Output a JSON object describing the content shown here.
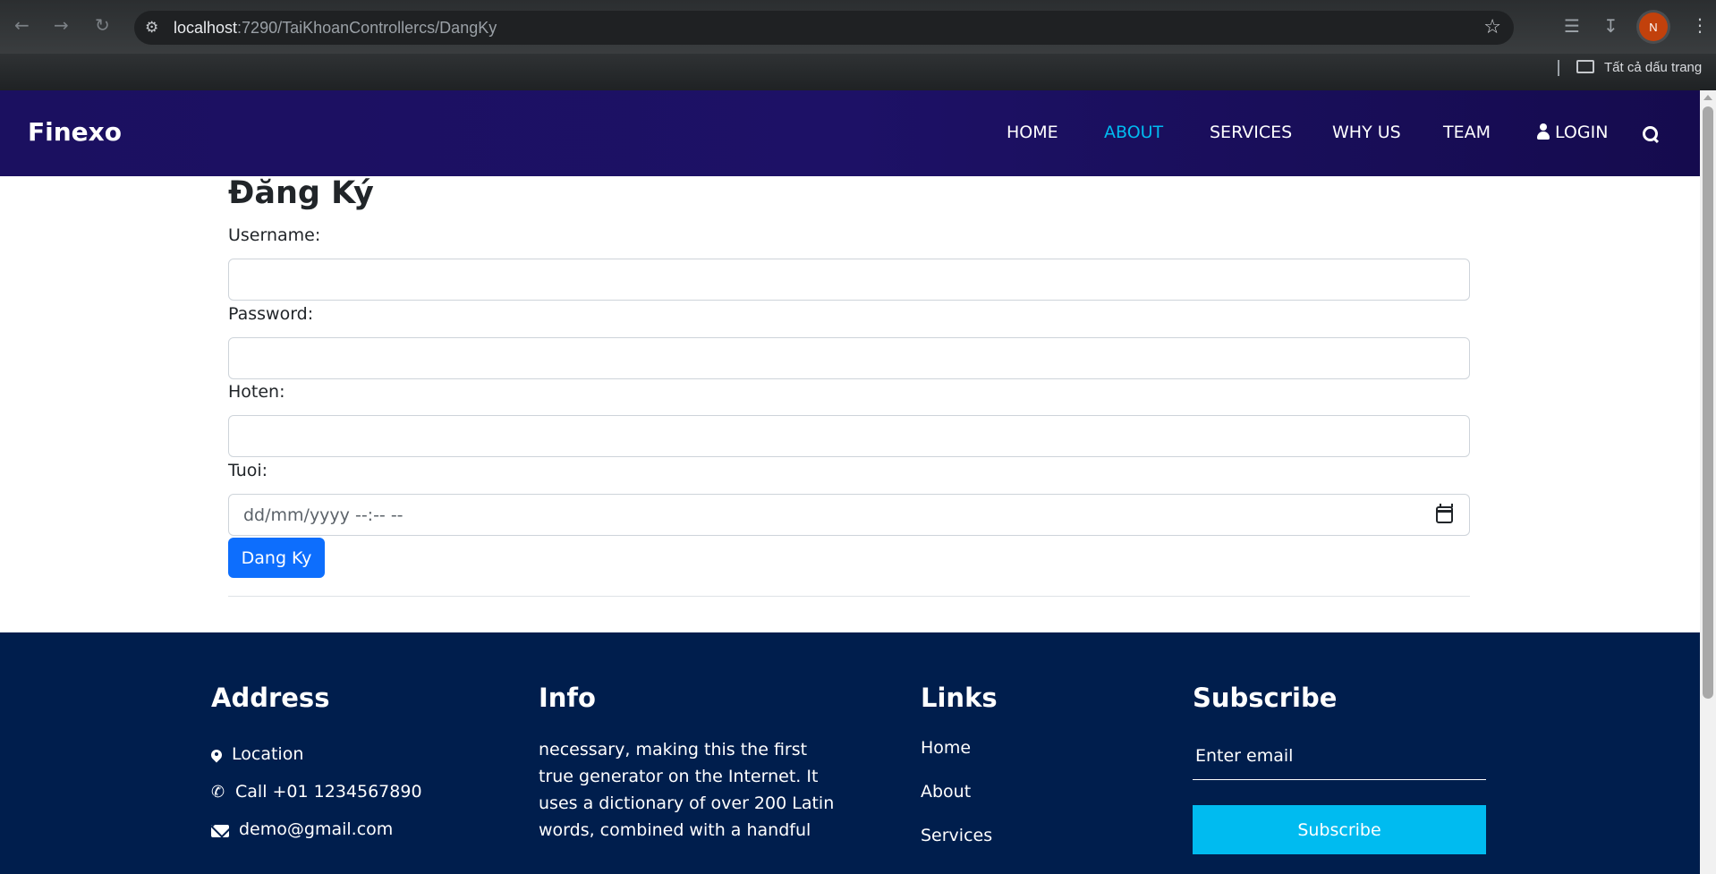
{
  "browser": {
    "url_host": "localhost",
    "url_path": ":7290/TaiKhoanControllercs/DangKy",
    "profile_initial": "N",
    "bookmarks_label": "Tất cả dấu trang"
  },
  "header": {
    "brand": "Finexo",
    "menu": [
      "HOME",
      "ABOUT",
      "SERVICES",
      "WHY US",
      "TEAM"
    ],
    "active_menu": "ABOUT",
    "login_label": "LOGIN",
    "accent_color": "#00bbf0",
    "background_color": "#1b1060"
  },
  "form": {
    "title": "Đăng Ký",
    "username_label": "Username:",
    "username_value": "",
    "password_label": "Password:",
    "password_value": "",
    "hoten_label": "Hoten:",
    "hoten_value": "",
    "tuoi_label": "Tuoi:",
    "tuoi_placeholder": "dd/mm/yyyy --:-- --",
    "submit_label": "Dang Ky",
    "button_color": "#0d6efd"
  },
  "footer": {
    "background_color": "#001e4d",
    "address": {
      "heading": "Address",
      "location": "Location",
      "call": "Call +01 1234567890",
      "email": "demo@gmail.com"
    },
    "info": {
      "heading": "Info",
      "text": "necessary, making this the first true generator on the Internet. It uses a dictionary of over 200 Latin words, combined with a handful"
    },
    "links": {
      "heading": "Links",
      "items": [
        "Home",
        "About",
        "Services"
      ]
    },
    "subscribe": {
      "heading": "Subscribe",
      "email_placeholder": "Enter email",
      "button_label": "Subscribe"
    }
  }
}
